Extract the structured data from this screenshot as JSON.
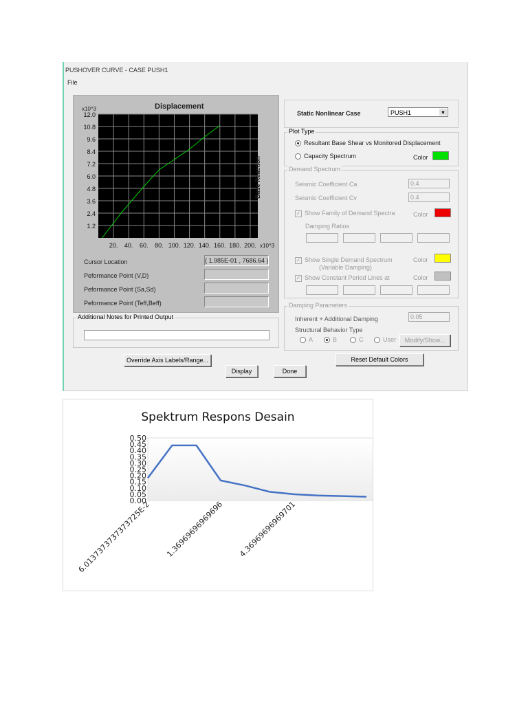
{
  "window": {
    "title": "PUSHOVER CURVE - CASE PUSH1",
    "menu": [
      "File"
    ]
  },
  "plot": {
    "title": "Displacement",
    "y_label": "Base Reaction",
    "y_scale": "x10^3",
    "x_scale": "x10^3",
    "y_ticks": [
      "12.0",
      "10.8",
      "9.6",
      "8.4",
      "7.2",
      "6.0",
      "4.8",
      "3.6",
      "2.4",
      "1.2"
    ],
    "x_ticks": [
      "20.",
      "40.",
      "60.",
      "80.",
      "100.",
      "120.",
      "140.",
      "160.",
      "180.",
      "200."
    ],
    "curve_color": "#00cc00",
    "curve": [
      [
        5,
        0
      ],
      [
        30,
        2.4
      ],
      [
        60,
        5.0
      ],
      [
        80,
        6.6
      ],
      [
        100,
        7.6
      ],
      [
        120,
        8.6
      ],
      [
        140,
        9.8
      ],
      [
        160,
        10.9
      ]
    ]
  },
  "readouts": [
    {
      "label": "Cursor Location",
      "value": "( 1.985E-01 , 7686.64 )"
    },
    {
      "label": "Peformance Point (V,D)",
      "value": ""
    },
    {
      "label": "Peformance Point (Sa,Sd)",
      "value": ""
    },
    {
      "label": "Peformance Point (Teff,Beff)",
      "value": ""
    }
  ],
  "notes": {
    "legend": "Additional Notes for Printed Output",
    "value": ""
  },
  "buttons": {
    "override": "Override Axis Labels/Range...",
    "display": "Display",
    "done": "Done",
    "reset": "Reset Default Colors",
    "modify": "Modify/Show..."
  },
  "case": {
    "label": "Static Nonlinear Case",
    "value": "PUSH1"
  },
  "plot_type": {
    "legend": "Plot Type",
    "opt1": "Resultant Base Shear vs Monitored Displacement",
    "opt2": "Capacity Spectrum",
    "color_label": "Color",
    "color": "#00e000"
  },
  "demand": {
    "legend": "Demand Spectrum",
    "ca_label": "Seismic Coefficient  Ca",
    "ca": "0.4",
    "cv_label": "Seismic Coefficient  Cv",
    "cv": "0.4",
    "family": "Show Family of Demand Spectra",
    "family_color": "#ee0000",
    "damping_ratios": "Damping Ratios",
    "single": "Show Single  Demand Spectrum",
    "single2": "(Variable Damping)",
    "single_color": "#ffff00",
    "period": "Show Constant Period Lines at",
    "period_color": "#c0c0c0",
    "color_label": "Color"
  },
  "damping": {
    "legend": "Damping Parameters",
    "inherent_label": "Inherent + Additional Damping",
    "inherent": "0.05",
    "behavior_label": "Structural Behavior Type",
    "types": [
      "A",
      "B",
      "C",
      "User"
    ],
    "selected": "B"
  },
  "chart_data": {
    "type": "line",
    "title": "Spektrum Respons Desain",
    "x_tick_labels": [
      "6.0137373737373725E-2",
      "",
      "",
      "1.36969696969696",
      "",
      "",
      "4.36969696969701",
      "",
      "",
      ""
    ],
    "values": [
      0.18,
      0.44,
      0.44,
      0.16,
      0.12,
      0.07,
      0.05,
      0.04,
      0.035,
      0.03
    ],
    "ylim": [
      0,
      0.5
    ],
    "y_ticks": [
      "0.50",
      "0.45",
      "0.40",
      "0.35",
      "0.30",
      "0.25",
      "0.20",
      "0.15",
      "0.10",
      "0.05",
      "0.00"
    ],
    "color": "#4472c4"
  }
}
